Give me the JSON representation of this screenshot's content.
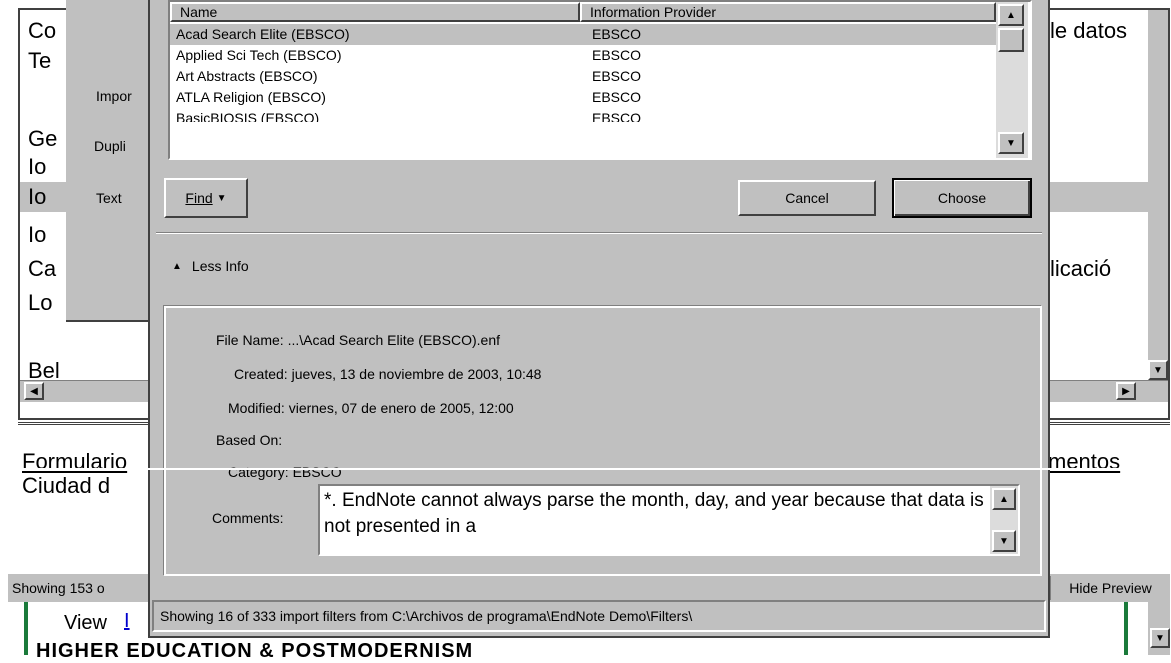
{
  "background": {
    "left_lines": [
      "Co",
      "Te",
      "",
      "Ge",
      "Io",
      "Io",
      "Io",
      "Ca",
      "Lo"
    ],
    "right_lines": [
      "le datos",
      "licació"
    ],
    "small_labels": [
      "Impor",
      "Dupli",
      "Text"
    ],
    "bottom_left": "Bel",
    "preview_line1": "Formulario",
    "preview_line2": "Ciudad d",
    "preview_right": "mentos",
    "status_left": "Showing 153 o",
    "hide_preview": "Hide Preview",
    "view_label": "View",
    "view_link": "I",
    "bottom_heading": "HIGHER EDUCATION & POSTMODERNISM"
  },
  "dialog": {
    "columns": {
      "name": "Name",
      "provider": "Information Provider"
    },
    "rows": [
      {
        "name": "Acad Search Elite (EBSCO)",
        "provider": "EBSCO"
      },
      {
        "name": "Applied Sci Tech (EBSCO)",
        "provider": "EBSCO"
      },
      {
        "name": "Art Abstracts (EBSCO)",
        "provider": "EBSCO"
      },
      {
        "name": "ATLA Religion (EBSCO)",
        "provider": "EBSCO"
      },
      {
        "name": "BasicBIOSIS (EBSCO)",
        "provider": "EBSCO"
      }
    ],
    "find_label": "Find",
    "cancel_label": "Cancel",
    "choose_label": "Choose",
    "less_info_label": "Less Info",
    "file_name_label": "File Name:",
    "file_name_value": "...\\Acad Search Elite (EBSCO).enf",
    "created_label": "Created:",
    "created_value": "jueves, 13 de noviembre de 2003, 10:48",
    "modified_label": "Modified:",
    "modified_value": "viernes, 07 de enero de 2005, 12:00",
    "based_on_label": "Based On:",
    "based_on_value": "",
    "category_label": "Category:",
    "category_value": "EBSCO",
    "comments_label": "Comments:",
    "comments_value": "*. EndNote cannot always parse the month, day, and year because that data is not presented in a",
    "status": "Showing 16 of 333 import filters from C:\\Archivos de programa\\EndNote Demo\\Filters\\"
  }
}
